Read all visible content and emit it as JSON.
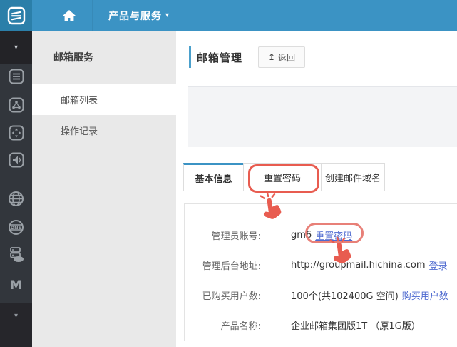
{
  "navbar": {
    "brand_icon": "hichina-cloud-logo",
    "home_icon": "home",
    "menu_label": "产品与服务",
    "menu_caret": "▾"
  },
  "rail": {
    "top_caret": "▾",
    "bottom_caret": "▾",
    "icons": [
      "collapse-caret",
      "product-list",
      "network-nodes",
      "compass-arrows",
      "voice",
      "globe",
      "dns-globe",
      "server-cloud",
      "m-logo",
      "expand-caret"
    ],
    "m_label": "M"
  },
  "sidebar": {
    "title": "邮箱服务",
    "items": [
      {
        "label": "邮箱列表",
        "active": true
      },
      {
        "label": "操作记录",
        "active": false
      }
    ]
  },
  "page": {
    "title": "邮箱管理",
    "back_icon": "↥",
    "back_label": "返回"
  },
  "tabs": [
    {
      "label": "基本信息",
      "active": true
    },
    {
      "label": "重置密码",
      "annotated": true
    },
    {
      "label": "创建邮件域名"
    }
  ],
  "details": {
    "rows": [
      {
        "label": "管理员账号:",
        "value": "gm6",
        "link": "重置密码"
      },
      {
        "label": "管理后台地址:",
        "value": "http://groupmail.hichina.com",
        "link": "登录"
      },
      {
        "label": "已购买用户数:",
        "value": "100个(共102400G 空间)",
        "link": "购买用户数"
      },
      {
        "label": "产品名称:",
        "value": "企业邮箱集团版1T （原1G版）",
        "link": ""
      }
    ]
  },
  "colors": {
    "navbar_blue": "#3b93c4",
    "logo_tile_blue": "#2b7fa9",
    "rail_dark": "#32363c",
    "sidebar_gray": "#e9e9e9",
    "link_blue": "#4e6ad0",
    "annotation_red": "#e85c50"
  }
}
